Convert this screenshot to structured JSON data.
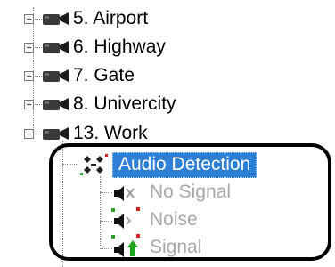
{
  "tree": {
    "cameras": [
      {
        "label": "5. Airport",
        "expanded": false,
        "icon": "camera-icon"
      },
      {
        "label": "6. Highway",
        "expanded": false,
        "icon": "camera-icon"
      },
      {
        "label": "7. Gate",
        "expanded": false,
        "icon": "camera-icon"
      },
      {
        "label": "8. Univercity",
        "expanded": false,
        "icon": "camera-icon"
      },
      {
        "label": "13. Work",
        "expanded": true,
        "icon": "camera-icon"
      }
    ],
    "detector": {
      "label": "Audio Detection",
      "selected": true,
      "icon": "audio-detector-icon"
    },
    "events": [
      {
        "label": "No Signal",
        "icon": "speaker-no-signal-icon"
      },
      {
        "label": "Noise",
        "icon": "speaker-noise-icon"
      },
      {
        "label": "Signal",
        "icon": "speaker-signal-icon"
      }
    ]
  },
  "colors": {
    "selection": "#2e7fd6",
    "disabled_text": "#a8a8a8"
  }
}
